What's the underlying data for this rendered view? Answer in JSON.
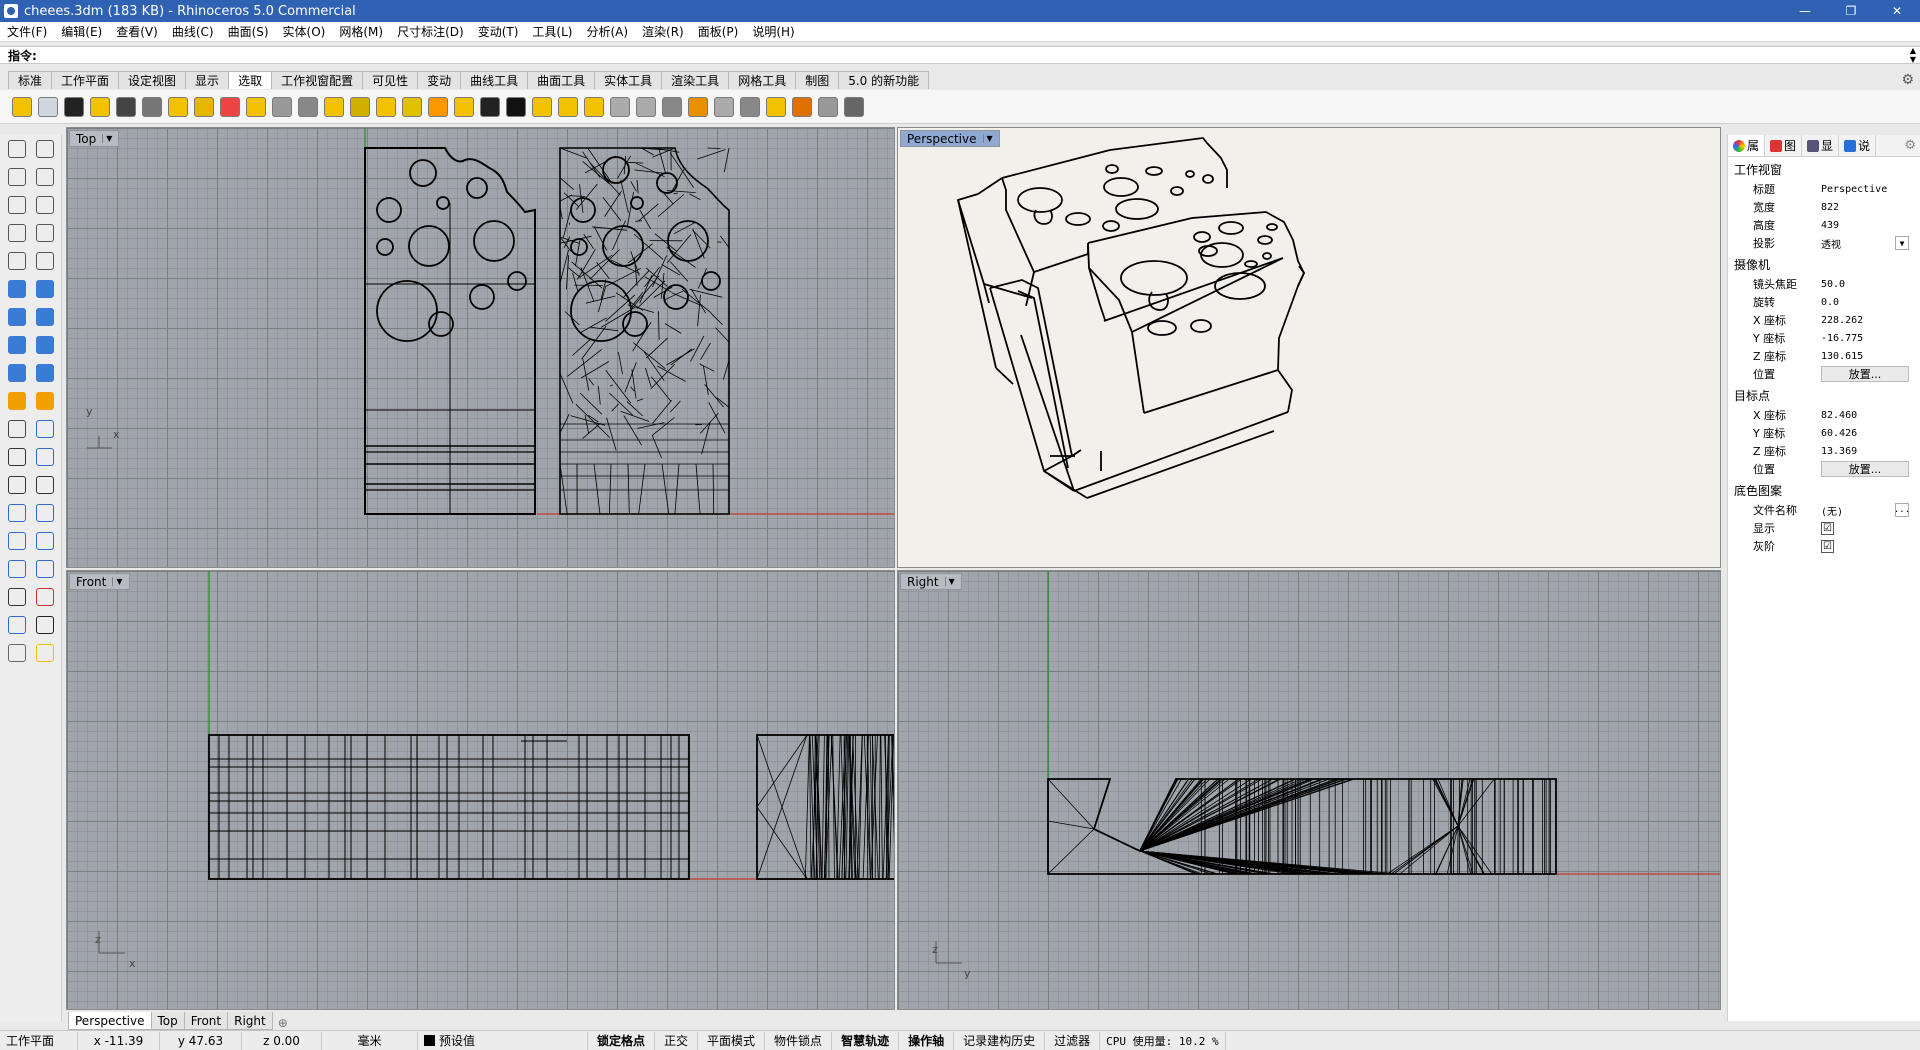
{
  "window": {
    "title": "cheees.3dm (183 KB) - Rhinoceros 5.0 Commercial",
    "minimize": "—",
    "maximize": "❐",
    "close": "✕"
  },
  "menu": [
    "文件(F)",
    "编辑(E)",
    "查看(V)",
    "曲线(C)",
    "曲面(S)",
    "实体(O)",
    "网格(M)",
    "尺寸标注(D)",
    "变动(T)",
    "工具(L)",
    "分析(A)",
    "渲染(R)",
    "面板(P)",
    "说明(H)"
  ],
  "command": {
    "label": "指令:",
    "value": ""
  },
  "toolbar_tabs": [
    "标准",
    "工作平面",
    "设定视图",
    "显示",
    "选取",
    "工作视窗配置",
    "可见性",
    "变动",
    "曲线工具",
    "曲面工具",
    "实体工具",
    "渲染工具",
    "网格工具",
    "制图",
    "5.0 的新功能"
  ],
  "active_toolbar_tab": "选取",
  "viewports": {
    "top": {
      "label": "Top"
    },
    "perspective": {
      "label": "Perspective"
    },
    "front": {
      "label": "Front"
    },
    "right": {
      "label": "Right"
    }
  },
  "axis_labels": {
    "top": {
      "v": "y",
      "h": "x"
    },
    "front": {
      "v": "z",
      "h": "x"
    },
    "right": {
      "v": "z",
      "h": "y"
    }
  },
  "properties": {
    "tabs": [
      "属",
      "图",
      "显",
      "说"
    ],
    "viewport_section": "工作视窗",
    "rows_viewport": [
      {
        "label": "标题",
        "value": "Perspective"
      },
      {
        "label": "宽度",
        "value": "822"
      },
      {
        "label": "高度",
        "value": "439"
      },
      {
        "label": "投影",
        "value": "透视"
      }
    ],
    "camera_section": "摄像机",
    "rows_camera": [
      {
        "label": "镜头焦距",
        "value": "50.0"
      },
      {
        "label": "旋转",
        "value": "0.0"
      },
      {
        "label": "X 座标",
        "value": "228.262"
      },
      {
        "label": "Y 座标",
        "value": "-16.775"
      },
      {
        "label": "Z 座标",
        "value": "130.615"
      }
    ],
    "camera_position": {
      "label": "位置",
      "button": "放置..."
    },
    "target_section": "目标点",
    "rows_target": [
      {
        "label": "X 座标",
        "value": "82.460"
      },
      {
        "label": "Y 座标",
        "value": "60.426"
      },
      {
        "label": "Z 座标",
        "value": "13.369"
      }
    ],
    "target_position": {
      "label": "位置",
      "button": "放置..."
    },
    "wallpaper_section": "底色图案",
    "filename": {
      "label": "文件名称",
      "value": "(无)",
      "browse": "..."
    },
    "show": {
      "label": "显示",
      "checked": "☑"
    },
    "gray": {
      "label": "灰阶",
      "checked": "☑"
    }
  },
  "viewport_tabs": [
    "Perspective",
    "Top",
    "Front",
    "Right"
  ],
  "viewport_tab_add": "⊕",
  "status": {
    "cplane": "工作平面",
    "x": "x -11.39",
    "y": "y 47.63",
    "z": "z 0.00",
    "units": "毫米",
    "layer": "预设值",
    "toggles": [
      "锁定格点",
      "正交",
      "平面模式",
      "物件锁点",
      "智慧轨迹",
      "操作轴",
      "记录建构历史",
      "过滤器"
    ],
    "bold_toggles": [
      "锁定格点",
      "智慧轨迹",
      "操作轴"
    ],
    "cpu": "CPU 使用量: 10.2 %"
  },
  "colors": {
    "titlebar": "#2f62b3",
    "x_axis": "#c0392b",
    "y_axis": "#1e8e1e",
    "active_viewport_label": "#8fa9d3"
  }
}
